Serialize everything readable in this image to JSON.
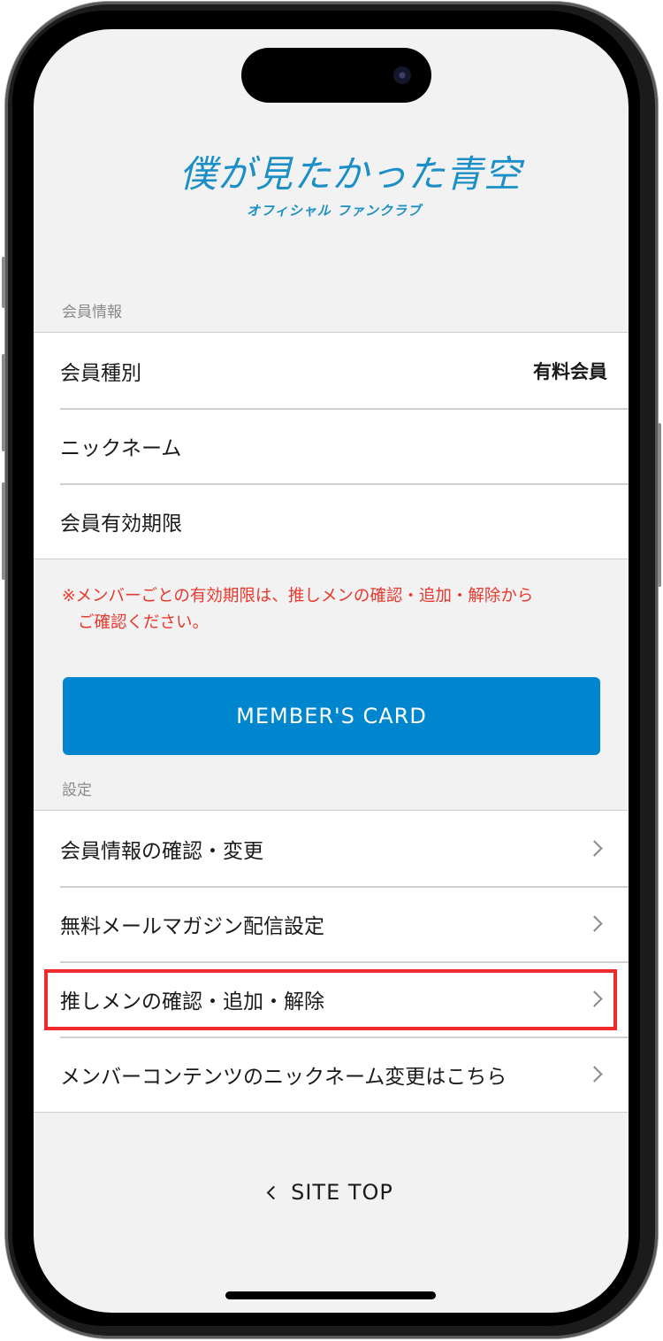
{
  "logo": {
    "title": "僕が見たかった青空",
    "subtitle": "オフィシャル ファンクラブ"
  },
  "member_info": {
    "heading": "会員情報",
    "rows": [
      {
        "label": "会員種別",
        "value": "有料会員"
      },
      {
        "label": "ニックネーム",
        "value": ""
      },
      {
        "label": "会員有効期限",
        "value": ""
      }
    ]
  },
  "notice": {
    "line1": "※メンバーごとの有効期限は、推しメンの確認・追加・解除から",
    "line2": "ご確認ください。"
  },
  "member_card_button": "MEMBER'S CARD",
  "settings": {
    "heading": "設定",
    "rows": [
      {
        "label": "会員情報の確認・変更"
      },
      {
        "label": "無料メールマガジン配信設定"
      },
      {
        "label": "推しメンの確認・追加・解除",
        "highlighted": true
      },
      {
        "label": "メンバーコンテンツのニックネーム変更はこちら"
      }
    ]
  },
  "site_top": "SITE TOP",
  "colors": {
    "brand_blue": "#0086cf",
    "notice_red": "#e8392f",
    "highlight_red": "#ef2b2b"
  }
}
